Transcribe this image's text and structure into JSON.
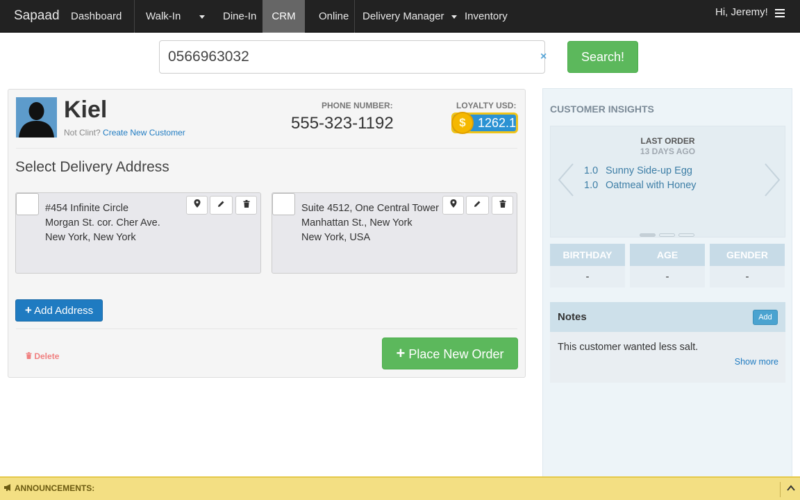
{
  "nav": {
    "brand": "Sapaad",
    "items": [
      "Dashboard",
      "Walk-In",
      "Dine-In",
      "CRM",
      "Online",
      "Delivery Manager",
      "Inventory"
    ],
    "active": "CRM",
    "greeting": "Hi, Jeremy!"
  },
  "search": {
    "value": "0566963032",
    "clear_icon": "×",
    "button_label": "Search!"
  },
  "customer": {
    "name": "Kiel",
    "not_client_text": "Not Clint?",
    "create_link": "Create New Customer",
    "phone_label": "PHONE NUMBER:",
    "phone": "555-323-1192",
    "loyalty_label": "LOYALTY USD:",
    "loyalty_value": "1262.1",
    "coin_symbol": "$"
  },
  "delivery": {
    "title": "Select Delivery Address",
    "addresses": [
      {
        "line1": "#454 Infinite Circle",
        "line2": "Morgan St. cor. Cher Ave.",
        "line3": "New York, New York"
      },
      {
        "line1": "Suite 4512, One Central Tower",
        "line2": "Manhattan St., New York",
        "line3": "New York, USA"
      }
    ],
    "add_address_label": "Add Address",
    "delete_label": "Delete",
    "place_order_label": "Place New Order"
  },
  "insights": {
    "title": "CUSTOMER INSIGHTS",
    "last_order_label": "LAST ORDER",
    "last_order_ago": "13 DAYS AGO",
    "order_items": [
      {
        "qty": "1.0",
        "name": "Sunny Side-up Egg"
      },
      {
        "qty": "1.0",
        "name": "Oatmeal with Honey"
      }
    ],
    "stats": [
      {
        "label": "BIRTHDAY",
        "value": "-"
      },
      {
        "label": "AGE",
        "value": "-"
      },
      {
        "label": "GENDER",
        "value": "-"
      }
    ],
    "notes_title": "Notes",
    "notes_add": "Add",
    "notes_text": "This customer wanted less salt.",
    "show_more": "Show more"
  },
  "announcements": {
    "label": "ANNOUNCEMENTS:"
  },
  "colors": {
    "navbar": "#222222",
    "active_nav": "#666666",
    "primary": "#1f7bc1",
    "success": "#5cb85c",
    "announce_bg": "#f3df83"
  }
}
